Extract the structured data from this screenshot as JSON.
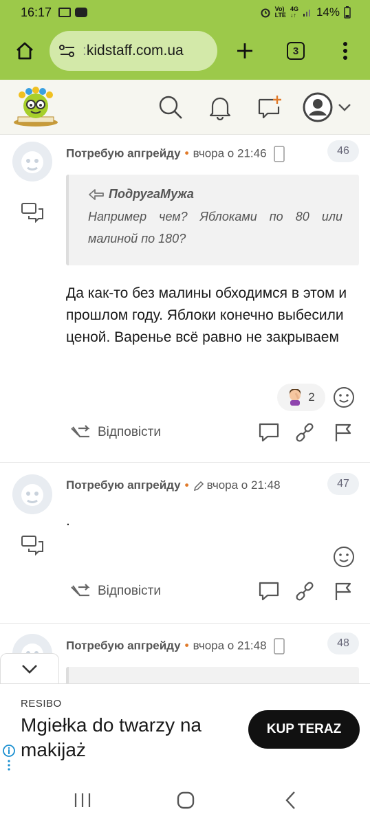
{
  "status_bar": {
    "time": "16:17",
    "battery": "14%"
  },
  "browser": {
    "url": "kidstaff.com.ua",
    "url_prefix": ":",
    "tabs_count": "3"
  },
  "posts": [
    {
      "author": "Потребую апгрейду",
      "time": "вчора о 21:46",
      "number": "46",
      "quote_author": "ПодругаМужа",
      "quote_text": "Например чем? Яблоками по 80 или малиной по 180?",
      "body": "Да как-то без малины обходимся в этом и прошлом году. Яблоки конечно выбесили ценой. Варенье всё равно не закрываем",
      "reaction_count": "2",
      "reply_label": "Відповісти"
    },
    {
      "author": "Потребую апгрейду",
      "time": "вчора о 21:48",
      "number": "47",
      "body": ".",
      "reply_label": "Відповісти"
    },
    {
      "author": "Потребую апгрейду",
      "time": "вчора о 21:48",
      "number": "48"
    }
  ],
  "ad": {
    "brand": "RESIBO",
    "title": "Mgiełka do twarzy na makijaż",
    "cta": "KUP TERAZ"
  },
  "colors": {
    "browser_green": "#9cc94a",
    "accent_orange": "#e07a2a"
  }
}
